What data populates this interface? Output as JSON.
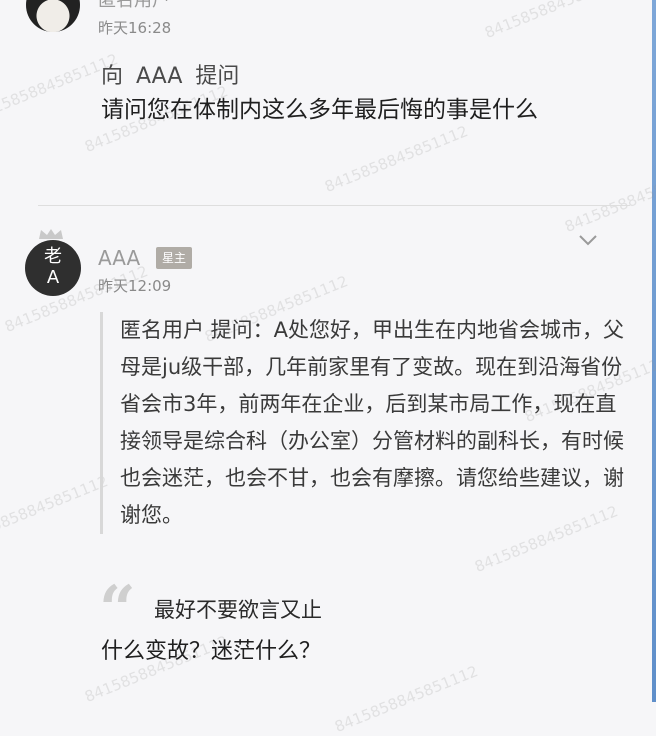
{
  "first_post": {
    "author": "匿名用户",
    "time": "昨天16:28",
    "ask_header": "向 AAA 提问",
    "question": "请问您在体制内这么多年最后悔的事是什么"
  },
  "second_post": {
    "avatar_text_top": "老",
    "avatar_text_bottom": "A",
    "author": "AAA",
    "badge": "星主",
    "time": "昨天12:09",
    "quoted_question": "匿名用户 提问：A处您好，甲出生在内地省会城市，父母是ju级干部，几年前家里有了变故。现在到沿海省份省会市3年，前两年在企业，后到某市局工作，现在直接领导是综合科（办公室）分管材料的副科长，有时候也会迷茫，也会不甘，也会有摩擦。请您给些建议，谢谢您。",
    "quote_mark": "“",
    "quote_ref": "最好不要欲言又止",
    "reply": "什么变故？迷茫什么？"
  },
  "watermark": "8415858845851112"
}
